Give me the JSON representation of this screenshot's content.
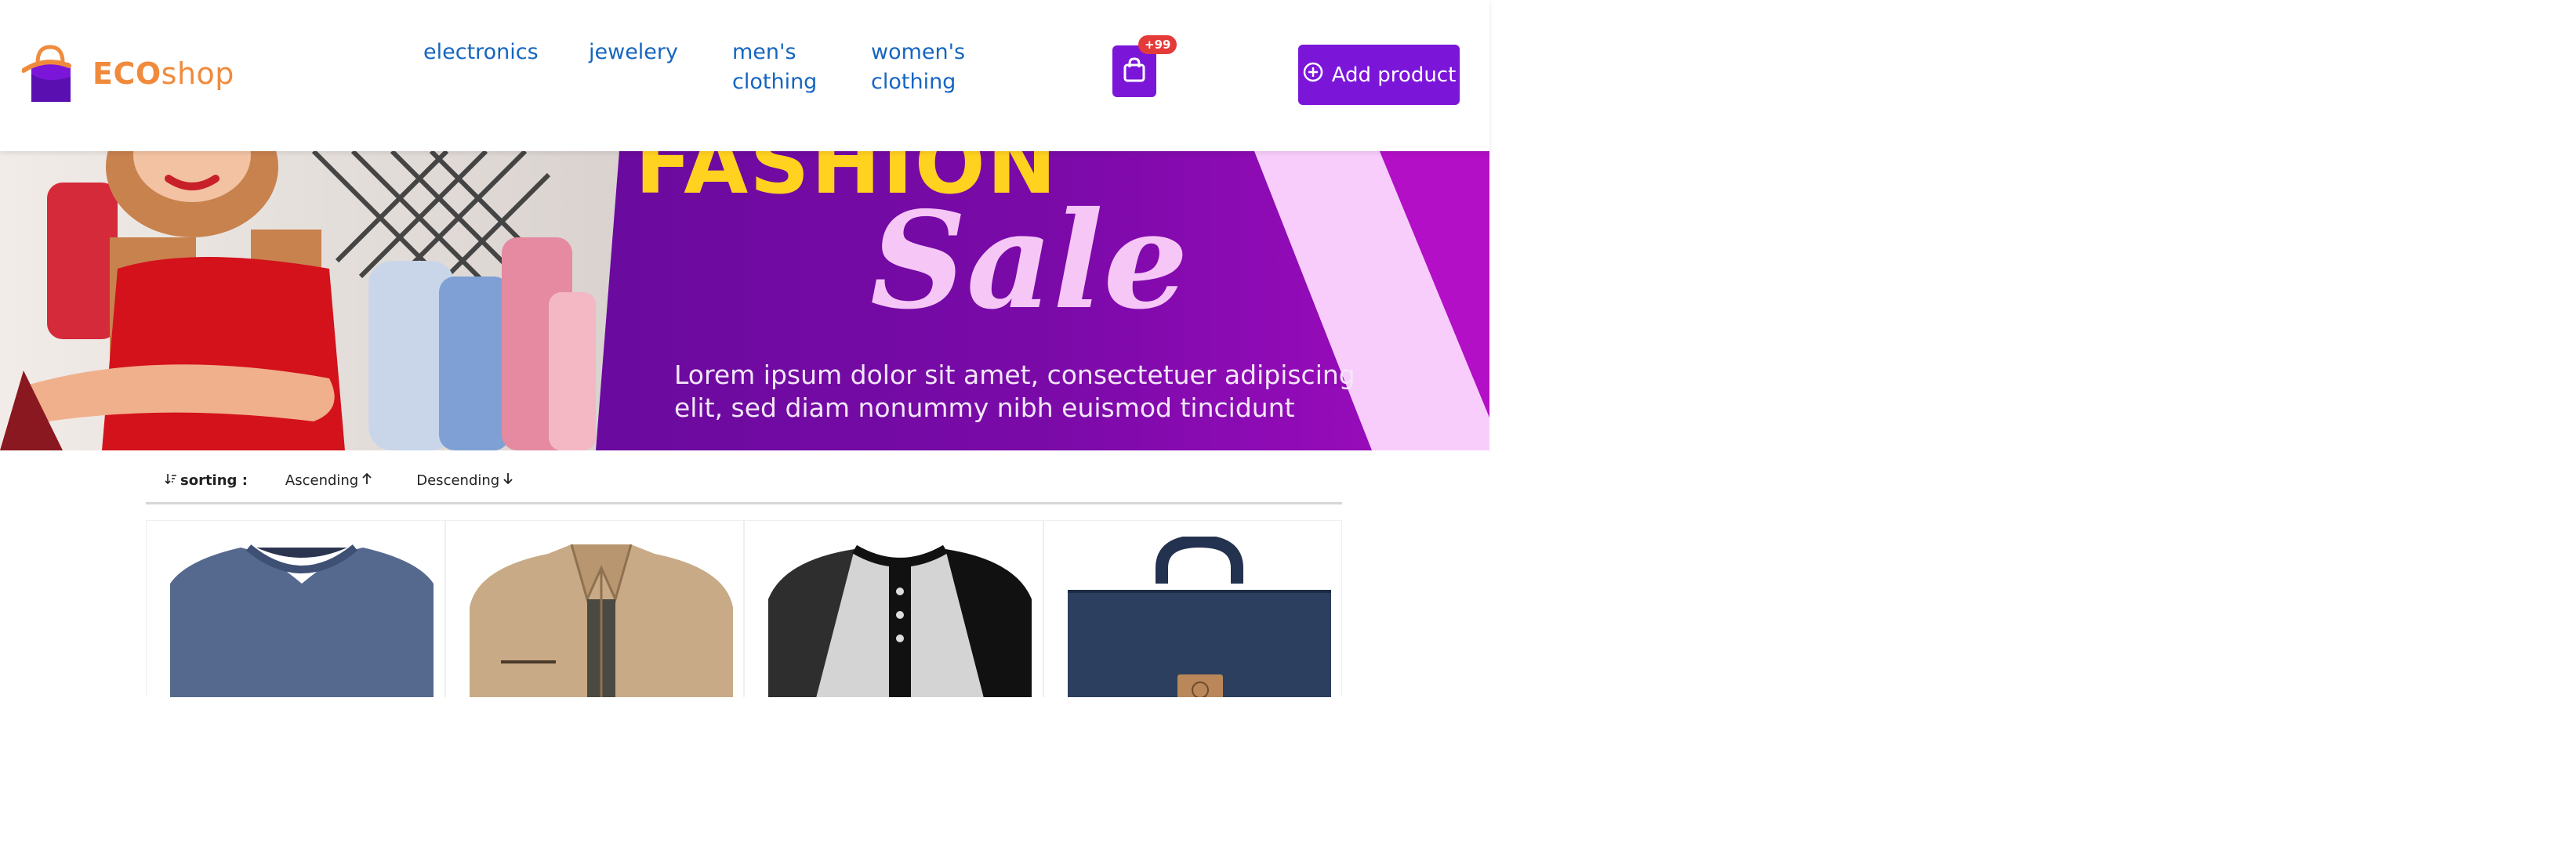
{
  "brand": {
    "name_bold": "ECO",
    "name_rest": "shop",
    "icon": "shopping-bag-logo-icon",
    "color": "#f08a3c"
  },
  "nav": {
    "links": [
      {
        "line1": "electronics",
        "line2": ""
      },
      {
        "line1": "jewelery",
        "line2": ""
      },
      {
        "line1": "men's",
        "line2": "clothing"
      },
      {
        "line1": "women's",
        "line2": "clothing"
      }
    ]
  },
  "cart": {
    "badge": "+99",
    "icon": "shopping-bag-icon"
  },
  "add_product": {
    "label": "Add product",
    "icon": "plus-circle-icon"
  },
  "banner": {
    "title": "FASHION",
    "script": "Sale",
    "text_line1": "Lorem ipsum dolor sit amet, consectetuer adipiscing",
    "text_line2": "elit, sed diam nonummy nibh euismod tincidunt"
  },
  "sorting": {
    "label": "sorting :",
    "label_icon": "sort-icon",
    "ascending": "Ascending",
    "descending": "Descending"
  },
  "products": [
    {
      "image": "blue-vneck-tshirt"
    },
    {
      "image": "beige-jacket"
    },
    {
      "image": "raglan-henley-shirt"
    },
    {
      "image": "navy-backpack"
    }
  ],
  "colors": {
    "accent": "#7b16d9",
    "link": "#1565c0",
    "badge": "#e43a3a"
  }
}
